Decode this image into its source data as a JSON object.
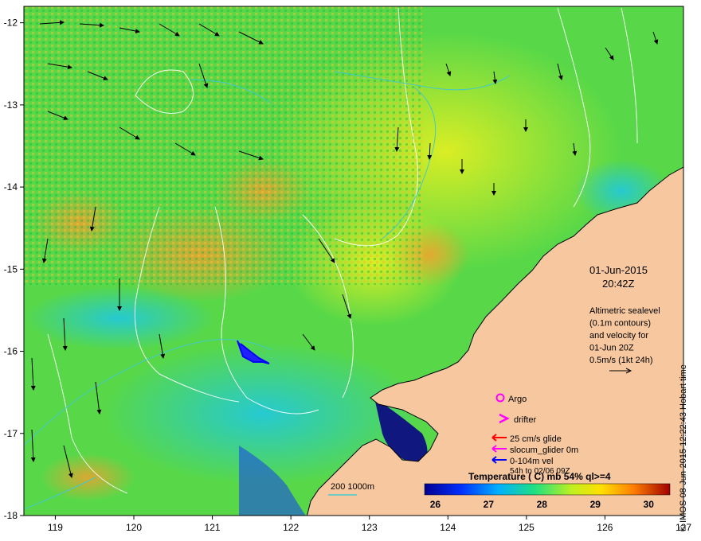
{
  "map": {
    "lon_ticks": [
      "119",
      "120",
      "121",
      "122",
      "123",
      "124",
      "125",
      "126",
      "127"
    ],
    "lat_ticks": [
      "-12",
      "-13",
      "-14",
      "-15",
      "-16",
      "-17",
      "-18"
    ],
    "extent": {
      "lon": [
        118.6,
        127.0
      ],
      "lat": [
        -18.0,
        -11.8
      ]
    }
  },
  "annotations": {
    "date": "01-Jun-2015",
    "time": "20:42Z",
    "altimetry": [
      "Altimetric sealevel",
      "(0.1m contours)",
      "and velocity for",
      "01-Jun 20Z",
      "0.5m/s (1kt 24h)"
    ]
  },
  "legend": {
    "argo": "Argo",
    "drifter": "drifter",
    "glide": "25 cm/s glide",
    "slocum": "slocum_glider 0m",
    "vel": "0-104m vel",
    "vel_period": "54h to 02/06 09Z",
    "bathy": "200  1000m",
    "colors": {
      "argo": "#ff00ff",
      "drifter": "#ff00ff",
      "glide": "#ff0000",
      "slocum": "#ff00ff",
      "vel": "#0000ff",
      "bathy": "#40c8d0",
      "land": "#f7c8a0"
    }
  },
  "colorbar": {
    "title": "Temperature ( C) mb 54% ql>=4",
    "ticks": [
      "26",
      "27",
      "28",
      "29",
      "30"
    ],
    "range": [
      25.8,
      30.4
    ]
  },
  "credit": "© IMOS 08-Jun-2015 12:22:43 Hobart time"
}
